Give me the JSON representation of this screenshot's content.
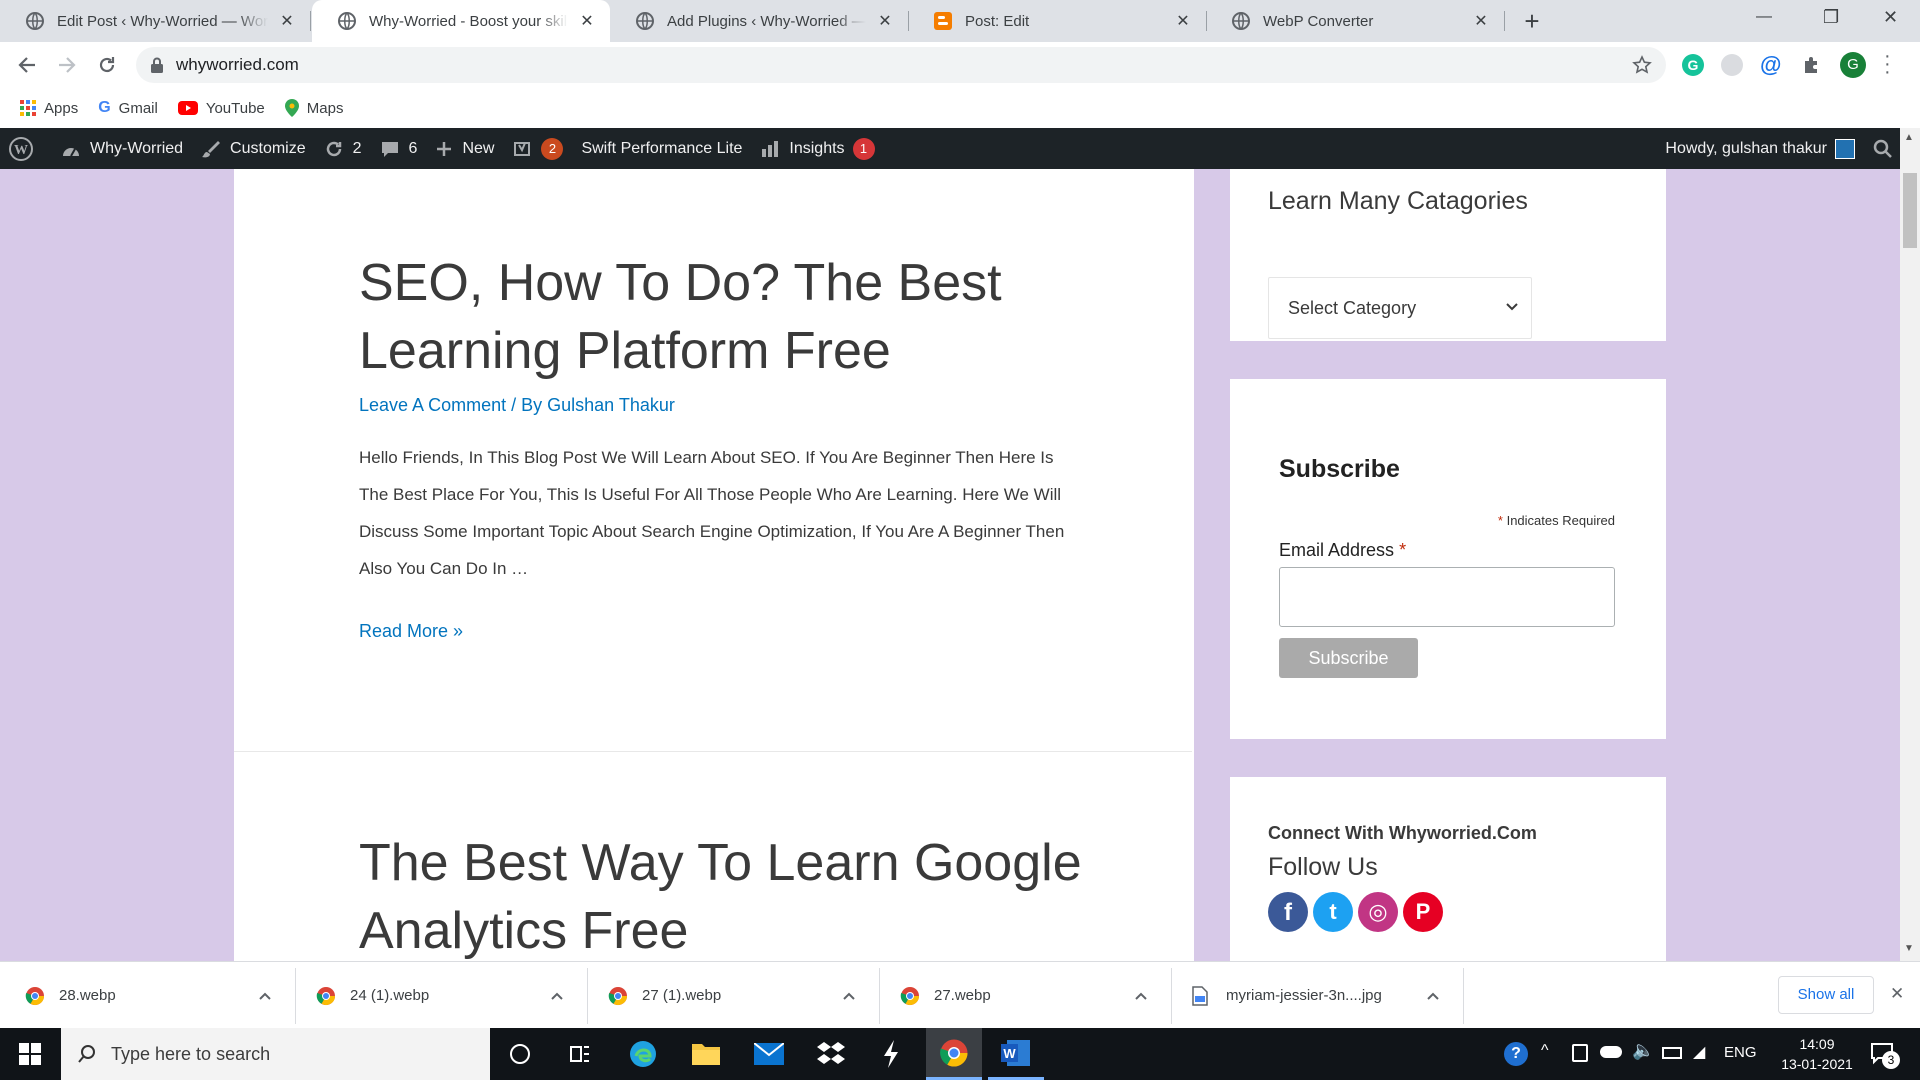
{
  "browser": {
    "tabs": [
      {
        "title": "Edit Post ‹ Why-Worried — WordPress",
        "close": "✕",
        "active": false
      },
      {
        "title": "Why-Worried - Boost your skills",
        "close": "✕",
        "active": true
      },
      {
        "title": "Add Plugins ‹ Why-Worried — WordPress",
        "close": "✕",
        "active": false
      },
      {
        "title": "Post: Edit",
        "close": "✕",
        "active": false
      },
      {
        "title": "WebP Converter",
        "close": "✕",
        "active": false
      }
    ],
    "new_tab": "+",
    "window_controls": {
      "minimize": "—",
      "maximize": "❐",
      "close": "✕"
    },
    "url": "whyworried.com",
    "profile_initial": "G",
    "bookmarks": [
      {
        "label": "Apps",
        "icon": "apps-grid-icon"
      },
      {
        "label": "Gmail",
        "icon": "google-g-icon"
      },
      {
        "label": "YouTube",
        "icon": "youtube-icon"
      },
      {
        "label": "Maps",
        "icon": "maps-pin-icon"
      }
    ]
  },
  "adminbar": {
    "site": "Why-Worried",
    "customize": "Customize",
    "updates": "2",
    "comments": "6",
    "new": "New",
    "yoast_count": "2",
    "swift": "Swift Performance Lite",
    "insights": "Insights",
    "insights_count": "1",
    "howdy": "Howdy, gulshan thakur"
  },
  "posts": [
    {
      "title_line1": "SEO, How To Do? The Best",
      "title_line2": "Learning Platform Free",
      "comment_link": "Leave A Comment",
      "by": " / By ",
      "author": "Gulshan Thakur",
      "excerpt": "Hello Friends, In This Blog Post We Will Learn About SEO. If You Are Beginner Then Here Is The Best Place For You, This Is Useful For All Those People Who Are Learning. Here We Will Discuss Some Important Topic About Search Engine Optimization, If You Are A Beginner Then Also You Can Do In …",
      "read_more": "Read More »"
    },
    {
      "title_line1": "The Best Way To Learn Google",
      "title_line2": "Analytics Free"
    }
  ],
  "sidebar": {
    "categories_title": "Learn Many Catagories",
    "select_value": "Select Category",
    "subscribe": {
      "title": "Subscribe",
      "required_note": "Indicates Required",
      "asterisk": "*",
      "email_label": "Email Address",
      "email_value": "",
      "button": "Subscribe"
    },
    "connect": {
      "title": "Connect With Whyworried.Com",
      "follow": "Follow Us",
      "social": [
        {
          "name": "facebook",
          "glyph": "f",
          "color": "#3b5998"
        },
        {
          "name": "twitter",
          "glyph": "t",
          "color": "#1da1f2"
        },
        {
          "name": "instagram",
          "glyph": "◎",
          "color": "#c13584"
        },
        {
          "name": "pinterest",
          "glyph": "P",
          "color": "#e60023"
        }
      ]
    }
  },
  "downloads": {
    "items": [
      "28.webp",
      "24 (1).webp",
      "27 (1).webp",
      "27.webp",
      "myriam-jessier-3n....jpg"
    ],
    "show_all": "Show all",
    "close": "✕"
  },
  "taskbar": {
    "search_placeholder": "Type here to search",
    "language": "ENG",
    "time": "14:09",
    "date": "13-01-2021",
    "notifications": "3"
  }
}
